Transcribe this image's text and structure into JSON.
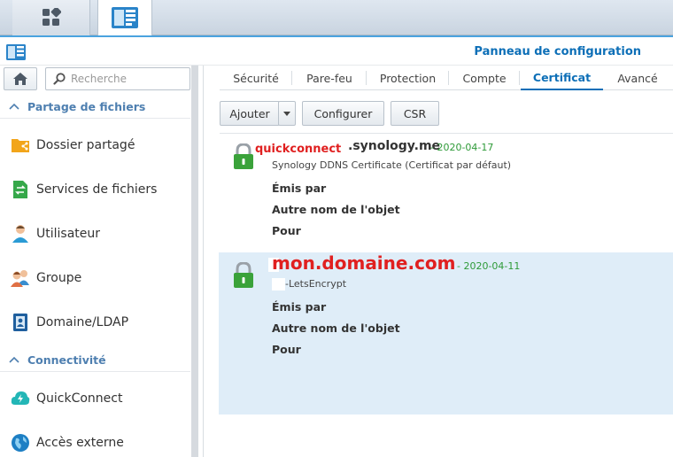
{
  "taskbar": {
    "buttons": [
      {
        "icon": "app-grid-icon"
      },
      {
        "icon": "control-panel-icon"
      }
    ]
  },
  "window": {
    "title": "Panneau de configuration",
    "icon": "control-panel-icon"
  },
  "sidebar": {
    "search_placeholder": "Recherche",
    "sections": [
      {
        "label": "Partage de fichiers",
        "items": [
          {
            "label": "Dossier partagé",
            "icon": "shared-folder-icon",
            "color": "#f2a51a"
          },
          {
            "label": "Services de fichiers",
            "icon": "file-services-icon",
            "color": "#36a84a"
          },
          {
            "label": "Utilisateur",
            "icon": "user-icon",
            "color": "#2a9bd5"
          },
          {
            "label": "Groupe",
            "icon": "group-icon",
            "color": "#e07045"
          },
          {
            "label": "Domaine/LDAP",
            "icon": "domain-ldap-icon",
            "color": "#1f5f9e"
          }
        ]
      },
      {
        "label": "Connectivité",
        "items": [
          {
            "label": "QuickConnect",
            "icon": "quickconnect-icon",
            "color": "#23b6b6"
          },
          {
            "label": "Accès externe",
            "icon": "external-access-icon",
            "color": "#1d7fc4"
          }
        ]
      }
    ]
  },
  "tabs": [
    {
      "label": "Sécurité",
      "active": false
    },
    {
      "label": "Pare-feu",
      "active": false
    },
    {
      "label": "Protection",
      "active": false
    },
    {
      "label": "Compte",
      "active": false
    },
    {
      "label": "Certificat",
      "active": true
    },
    {
      "label": "Avancé",
      "active": false
    }
  ],
  "toolbar": {
    "add_label": "Ajouter",
    "configure_label": "Configurer",
    "csr_label": "CSR"
  },
  "certificates": [
    {
      "name": ".synology.me",
      "date": "- 2020-04-17",
      "description": "Synology DDNS Certificate (Certificat par défaut)",
      "overlay": "quickconnect",
      "fields": [
        "Émis par",
        "Autre nom de l'objet",
        "Pour"
      ],
      "selected": false
    },
    {
      "name": "",
      "date": "- 2020-04-11",
      "description": "-LetsEncrypt",
      "overlay": "mon.domaine.com",
      "fields": [
        "Émis par",
        "Autre nom de l'objet",
        "Pour"
      ],
      "selected": true
    }
  ],
  "colors": {
    "accent": "#0d6fb7",
    "section": "#4e7fb0",
    "date": "#2e9a38",
    "lock": "#3aa23a",
    "selected_bg": "#dfedf8",
    "overlay_red": "#e02020"
  }
}
